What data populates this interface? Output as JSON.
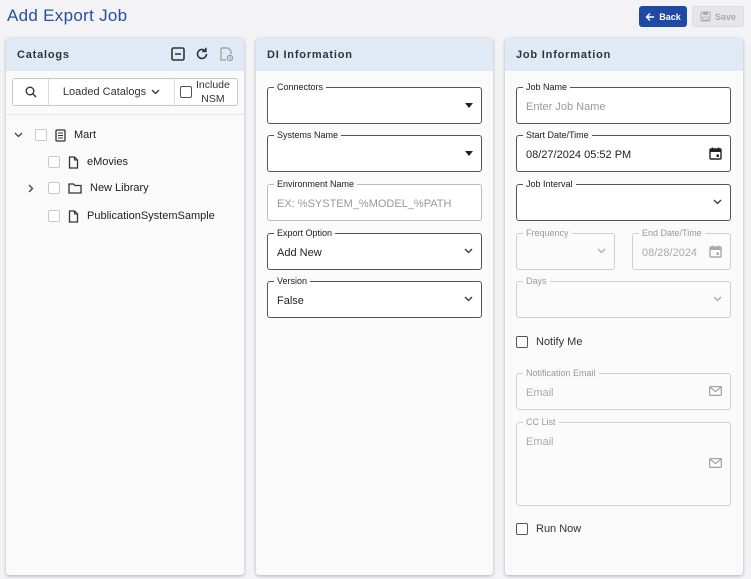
{
  "page": {
    "title": "Add Export Job"
  },
  "header": {
    "back_label": "Back",
    "save_label": "Save"
  },
  "catalogs": {
    "title": "Catalogs",
    "filter": {
      "dropdown_label": "Loaded Catalogs",
      "include_label_line1": "Include",
      "include_label_line2": "NSM"
    },
    "tree": [
      {
        "label": "Mart",
        "icon": "document-icon"
      },
      {
        "label": "eMovies",
        "icon": "file-icon"
      },
      {
        "label": "New Library",
        "icon": "folder-icon"
      },
      {
        "label": "PublicationSystemSample",
        "icon": "file-icon"
      }
    ]
  },
  "di": {
    "title": "DI Information",
    "connectors": {
      "label": "Connectors",
      "value": ""
    },
    "systems_name": {
      "label": "Systems Name",
      "value": ""
    },
    "environment_name": {
      "label": "Environment Name",
      "placeholder": "EX: %SYSTEM_%MODEL_%PATH"
    },
    "export_option": {
      "label": "Export Option",
      "value": "Add New"
    },
    "version": {
      "label": "Version",
      "value": "False"
    }
  },
  "job": {
    "title": "Job Information",
    "job_name": {
      "label": "Job Name",
      "placeholder": "Enter Job Name"
    },
    "start_datetime": {
      "label": "Start Date/Time",
      "value": "08/27/2024 05:52 PM"
    },
    "job_interval": {
      "label": "Job Interval",
      "value": ""
    },
    "frequency": {
      "label": "Frequency",
      "value": ""
    },
    "end_datetime": {
      "label": "End Date/Time",
      "value": "08/28/2024"
    },
    "days": {
      "label": "Days",
      "value": ""
    },
    "notify_me": {
      "label": "Notify Me",
      "checked": false
    },
    "notification_email": {
      "label": "Notification Email",
      "placeholder": "Email"
    },
    "cc_list": {
      "label": "CC List",
      "placeholder": "Email"
    },
    "run_now": {
      "label": "Run Now",
      "checked": false
    }
  },
  "colors": {
    "accent": "#1e4aa6",
    "header_bg": "#dfeaf6",
    "title": "#2350a0"
  }
}
